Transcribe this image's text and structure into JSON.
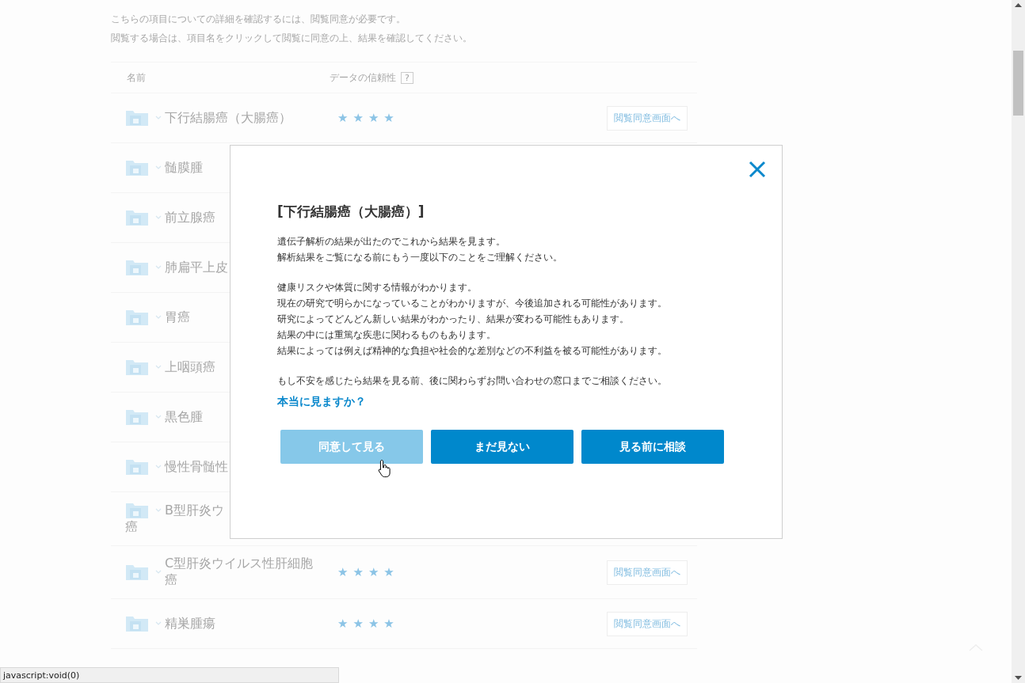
{
  "intro": [
    "こちらの項目についての詳細を確認するには、閲覧同意が必要です。",
    "閲覧する場合は、項目名をクリックして閲覧に同意の上、結果を確認してください。"
  ],
  "table": {
    "columns": [
      "名前",
      "データの信頼性"
    ],
    "help_mark": "?",
    "rows": [
      {
        "name": "下行結腸癌（大腸癌）",
        "stars": 4,
        "link": "閲覧同意画面へ"
      },
      {
        "name": "髄膜腫"
      },
      {
        "name": "前立腺癌"
      },
      {
        "name": "肺扁平上皮"
      },
      {
        "name": "胃癌"
      },
      {
        "name": "上咽頭癌"
      },
      {
        "name": "黒色腫"
      },
      {
        "name": "慢性骨髄性"
      },
      {
        "name": "B型肝炎ウ",
        "name_continued": "癌"
      },
      {
        "name": "C型肝炎ウイルス性肝細胞癌",
        "stars": 4,
        "link": "閲覧同意画面へ"
      },
      {
        "name": "精巣腫瘍",
        "stars": 4,
        "link": "閲覧同意画面へ"
      }
    ]
  },
  "modal": {
    "title": "[下行結腸癌（大腸癌）]",
    "paragraphs": [
      [
        "遺伝子解析の結果が出たのでこれから結果を見ます。",
        "解析結果をご覧になる前にもう一度以下のことをご理解ください。"
      ],
      [
        "健康リスクや体質に関する情報がわかります。",
        "現在の研究で明らかになっていることがわかりますが、今後追加される可能性があります。",
        "研究によってどんどん新しい結果がわかったり、結果が変わる可能性もあります。",
        "結果の中には重篤な疾患に関わるものもあります。",
        "結果によっては例えば精神的な負担や社会的な差別などの不利益を被る可能性があります。"
      ],
      [
        "もし不安を感じたら結果を見る前、後に関わらずお問い合わせの窓口までご相談ください。"
      ]
    ],
    "question": "本当に見ますか？",
    "buttons": [
      {
        "label": "同意して見る",
        "hovered": true
      },
      {
        "label": "まだ見ない",
        "hovered": false
      },
      {
        "label": "見る前に相談",
        "hovered": false
      }
    ]
  },
  "status_bar": "javascript:void(0)"
}
